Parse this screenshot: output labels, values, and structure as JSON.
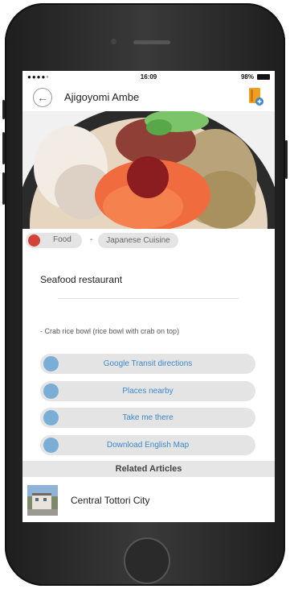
{
  "status_bar": {
    "signal": "●●●●▫",
    "time": "16:09",
    "battery": "98%"
  },
  "header": {
    "title": "Ajigoyomi Ambe",
    "back_icon": "back-arrow-icon",
    "guidebook_icon": "guidebook-add-icon"
  },
  "photo": {
    "alt": "seafood rice bowl"
  },
  "tags": {
    "category": "Food",
    "separator": "-",
    "subcategory": "Japanese Cuisine"
  },
  "description": "Seafood restaurant",
  "detail": "- Crab rice bowl (rice bowl with crab on top)",
  "actions": [
    {
      "label": "Google Transit directions",
      "icon": "train-icon"
    },
    {
      "label": "Places nearby",
      "icon": "radar-icon"
    },
    {
      "label": "Take me there",
      "icon": "walking-person-icon"
    },
    {
      "label": "Download English Map",
      "icon": "map-icon"
    }
  ],
  "related": {
    "heading": "Related Articles",
    "articles": [
      {
        "title": "Central Tottori City"
      }
    ]
  },
  "colors": {
    "accent": "#3c88c8",
    "icon_bg": "#7aaed6",
    "food_tag": "#d4433a",
    "pill_bg": "#e4e4e4"
  }
}
